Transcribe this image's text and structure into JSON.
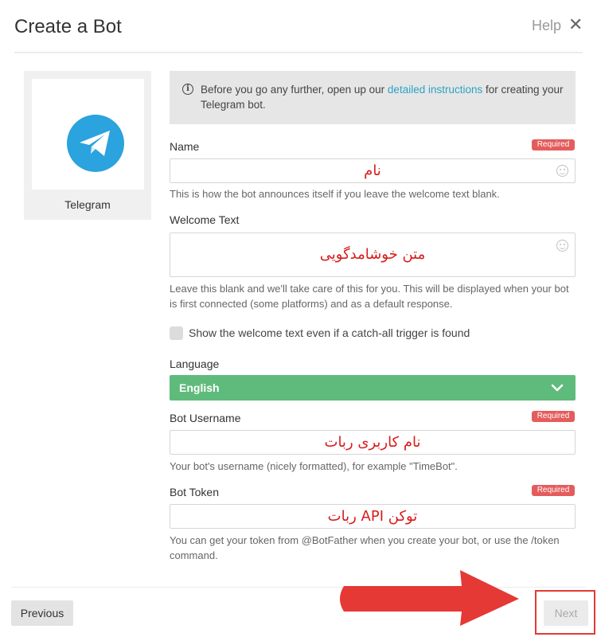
{
  "header": {
    "title": "Create a Bot",
    "help_label": "Help",
    "close_icon": "close-icon"
  },
  "platform": {
    "name": "Telegram",
    "icon": "telegram-icon",
    "brand_color": "#2aa3de"
  },
  "notice": {
    "icon": "info-icon",
    "text_before": "Before you go any further, open up our ",
    "link_text": "detailed instructions",
    "text_after": " for creating your Telegram bot."
  },
  "form": {
    "name": {
      "label": "Name",
      "badge": "Required",
      "value": "نام",
      "help": "This is how the bot announces itself if you leave the welcome text blank."
    },
    "welcome_text": {
      "label": "Welcome Text",
      "value": "متن خوشامدگویی",
      "help": "Leave this blank and we'll take care of this for you. This will be displayed when your bot is first connected (some platforms) and as a default response."
    },
    "catch_all": {
      "label": "Show the welcome text even if a catch-all trigger is found",
      "checked": false
    },
    "language": {
      "label": "Language",
      "value": "English",
      "color": "#5fbb7b"
    },
    "bot_username": {
      "label": "Bot Username",
      "badge": "Required",
      "value": "نام کاربری ربات",
      "help": "Your bot's username (nicely formatted), for example \"TimeBot\"."
    },
    "bot_token": {
      "label": "Bot Token",
      "badge": "Required",
      "value": "توکن API ربات",
      "help": "You can get your token from @BotFather when you create your bot, or use the /token command."
    }
  },
  "footer": {
    "previous_label": "Previous",
    "next_label": "Next"
  },
  "colors": {
    "required_badge": "#e45c5c",
    "annotation_red": "#e53935",
    "link": "#2aa3c4"
  }
}
